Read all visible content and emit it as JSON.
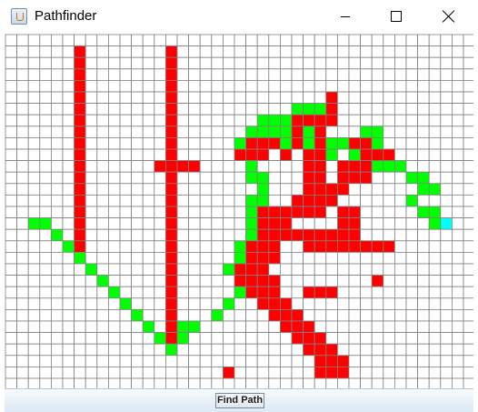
{
  "window": {
    "title": "Pathfinder",
    "icon": "java-cup-icon"
  },
  "controls": {
    "minimize": "minimize-icon",
    "maximize": "maximize-icon",
    "close": "close-icon"
  },
  "action": {
    "find_path_label": "Find Path"
  },
  "colors": {
    "wall": "#ff0000",
    "path": "#00ff00",
    "endpoint": "#00ffff",
    "empty": "#ffffff",
    "grid_line": "#808080"
  },
  "grid": {
    "cols": 41,
    "rows": 31,
    "cells": [
      "...........................................",
      "......R.......R..........................",
      "......R.......R..........................",
      "......R.......R..........................",
      "......R.......R..........................",
      "......R.......R.............R............",
      "......R.......R..........GGGR............",
      "......R.......R.......GGGRRRR............",
      "......R.......R......GGGGRGR...GG........",
      "......R.......R.....GRRRGRGRGGRRG........",
      "......R.......R.....RRR.R.RRG.GRRR......",
      "......R......RRRR....G....RR.RRRGGG......",
      "......R.......R......GG...RR.RRR...GG....",
      "......R.......R.......G...RRRR......GG...",
      "......R.......R......GG..RRRR......G.....",
      "......R.......R......GRRRRRR.RR.....GG...",
      "..GG..R.......R......GRRR....RR......GC..",
      "....G.R.......R......GRRRRRRRRR..........",
      ".....GR.......R.....GRRR..RRRRRRRR.......",
      "......G.......R.....GRRR.................",
      ".......G......R....GRRR..................",
      "........G.....R.....RRRR........R........",
      ".........G....R.....GRRR..RRR............",
      "..........G...R....G..RRR................",
      "...........G..R...G....RRR...............",
      "............G.RGG.......RRR..............",
      ".............GRG.........RRR.............",
      "..............G...........RRR............",
      "...........................RRR...........",
      "...................R.......RRR...........",
      "..........................................."
    ]
  }
}
